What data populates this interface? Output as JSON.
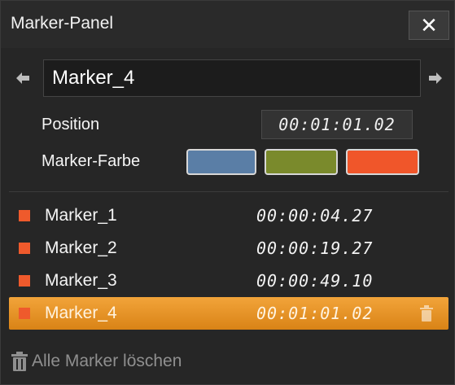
{
  "window": {
    "title": "Marker-Panel"
  },
  "navigator": {
    "current_name": "Marker_4"
  },
  "fields": {
    "position_label": "Position",
    "position_value": "00:01:01.02",
    "color_label": "Marker-Farbe"
  },
  "colors": {
    "swatch_blue": "#5a7ea6",
    "swatch_green": "#7a8a2c",
    "swatch_red": "#f0562a",
    "marker_square": "#ef5a2c",
    "selected_row": "#e88f22"
  },
  "markers": [
    {
      "name": "Marker_1",
      "time": "00:00:04.27"
    },
    {
      "name": "Marker_2",
      "time": "00:00:19.27"
    },
    {
      "name": "Marker_3",
      "time": "00:00:49.10"
    },
    {
      "name": "Marker_4",
      "time": "00:01:01.02"
    }
  ],
  "footer": {
    "delete_all_label": "Alle Marker löschen"
  },
  "icons": {
    "close": "close-icon",
    "prev": "arrow-left-icon",
    "next": "arrow-right-icon",
    "trash": "trash-icon"
  }
}
